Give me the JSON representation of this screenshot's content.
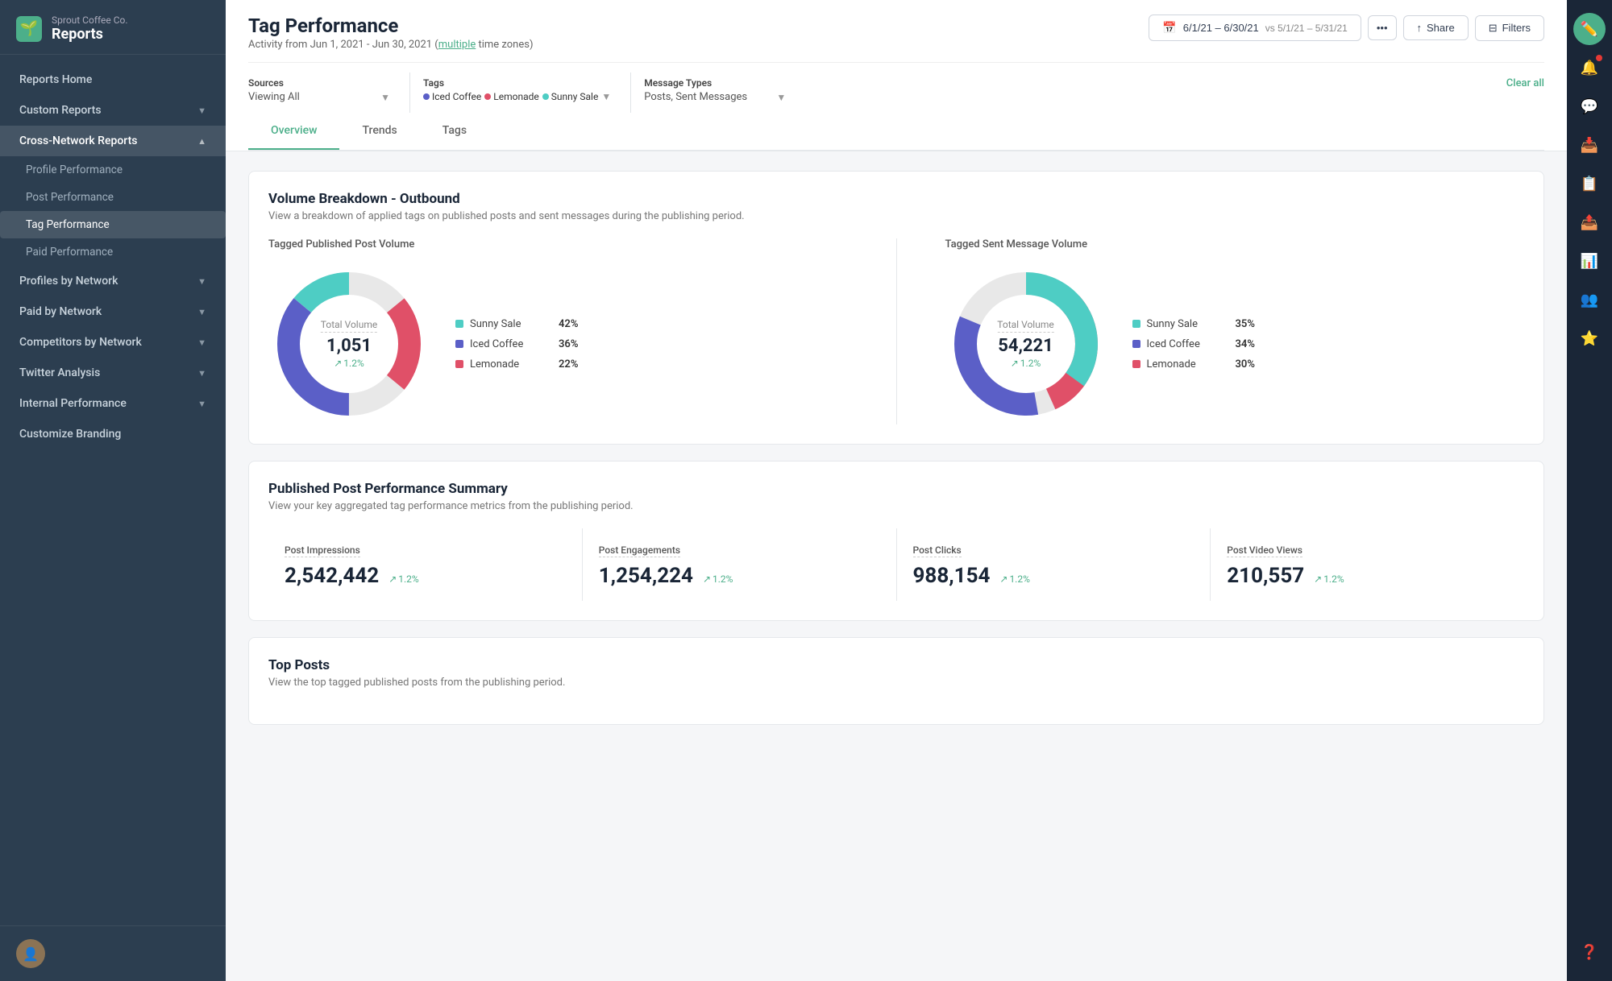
{
  "company": "Sprout Coffee Co.",
  "app": "Reports",
  "sidebar": {
    "reports_home": "Reports Home",
    "custom_reports": "Custom Reports",
    "cross_network": "Cross-Network Reports",
    "sub_items": [
      {
        "label": "Profile Performance",
        "active": false
      },
      {
        "label": "Post Performance",
        "active": false
      },
      {
        "label": "Tag Performance",
        "active": true
      },
      {
        "label": "Paid Performance",
        "active": false
      }
    ],
    "profiles_by_network": "Profiles by Network",
    "paid_by_network": "Paid by Network",
    "competitors_by_network": "Competitors by Network",
    "twitter_analysis": "Twitter Analysis",
    "internal_performance": "Internal Performance",
    "customize_branding": "Customize Branding"
  },
  "page": {
    "title": "Tag Performance",
    "subtitle": "Activity from Jun 1, 2021 - Jun 30, 2021",
    "subtitle_link": "multiple",
    "subtitle_suffix": "time zones)",
    "date_range": "6/1/21 – 6/30/21",
    "vs_range": "vs 5/1/21 – 5/31/21"
  },
  "filters": {
    "sources_label": "Sources",
    "sources_value": "Viewing All",
    "tags_label": "Tags",
    "tag1": "Iced Coffee",
    "tag2": "Lemonade",
    "tag3": "Sunny Sale",
    "message_types_label": "Message Types",
    "message_types_value": "Posts, Sent Messages",
    "clear_all": "Clear all"
  },
  "tabs": [
    "Overview",
    "Trends",
    "Tags"
  ],
  "active_tab": "Overview",
  "volume_card": {
    "title": "Volume Breakdown - Outbound",
    "desc": "View a breakdown of applied tags on published posts and sent messages during the publishing period.",
    "chart1_label": "Tagged Published Post Volume",
    "chart1_center_label": "Total Volume",
    "chart1_value": "1,051",
    "chart1_change": "1.2%",
    "chart2_label": "Tagged Sent Message Volume",
    "chart2_center_label": "Total Volume",
    "chart2_value": "54,221",
    "chart2_change": "1.2%",
    "legend1": [
      {
        "name": "Sunny Sale",
        "pct": "42%",
        "color": "#4ecdc4"
      },
      {
        "name": "Iced Coffee",
        "pct": "36%",
        "color": "#5b5fc7"
      },
      {
        "name": "Lemonade",
        "pct": "22%",
        "color": "#e05068"
      }
    ],
    "legend2": [
      {
        "name": "Sunny Sale",
        "pct": "35%",
        "color": "#4ecdc4"
      },
      {
        "name": "Iced Coffee",
        "pct": "34%",
        "color": "#5b5fc7"
      },
      {
        "name": "Lemonade",
        "pct": "30%",
        "color": "#e05068"
      }
    ]
  },
  "performance_card": {
    "title": "Published Post Performance Summary",
    "desc": "View your key aggregated tag performance metrics from the publishing period.",
    "stats": [
      {
        "name": "Post Impressions",
        "value": "2,542,442",
        "change": "1.2%"
      },
      {
        "name": "Post Engagements",
        "value": "1,254,224",
        "change": "1.2%"
      },
      {
        "name": "Post Clicks",
        "value": "988,154",
        "change": "1.2%"
      },
      {
        "name": "Post Video Views",
        "value": "210,557",
        "change": "1.2%"
      }
    ]
  },
  "top_posts_card": {
    "title": "Top Posts",
    "desc": "View the top tagged published posts from the publishing period."
  },
  "buttons": {
    "share": "Share",
    "filters": "Filters"
  }
}
